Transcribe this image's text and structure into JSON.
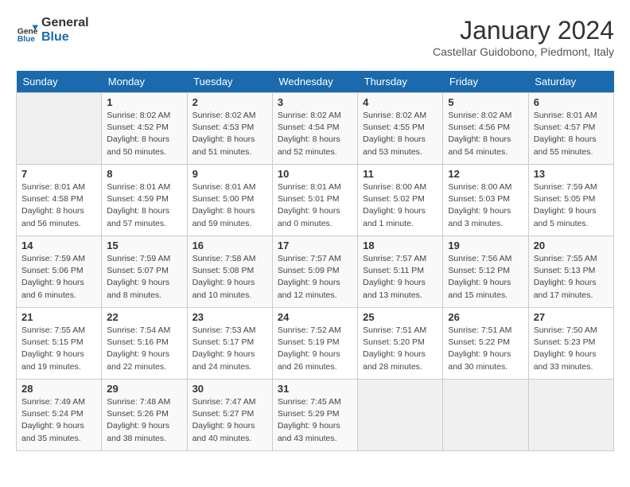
{
  "header": {
    "logo_line1": "General",
    "logo_line2": "Blue",
    "month": "January 2024",
    "location": "Castellar Guidobono, Piedmont, Italy"
  },
  "days_of_week": [
    "Sunday",
    "Monday",
    "Tuesday",
    "Wednesday",
    "Thursday",
    "Friday",
    "Saturday"
  ],
  "weeks": [
    [
      {
        "day": "",
        "info": ""
      },
      {
        "day": "1",
        "info": "Sunrise: 8:02 AM\nSunset: 4:52 PM\nDaylight: 8 hours\nand 50 minutes."
      },
      {
        "day": "2",
        "info": "Sunrise: 8:02 AM\nSunset: 4:53 PM\nDaylight: 8 hours\nand 51 minutes."
      },
      {
        "day": "3",
        "info": "Sunrise: 8:02 AM\nSunset: 4:54 PM\nDaylight: 8 hours\nand 52 minutes."
      },
      {
        "day": "4",
        "info": "Sunrise: 8:02 AM\nSunset: 4:55 PM\nDaylight: 8 hours\nand 53 minutes."
      },
      {
        "day": "5",
        "info": "Sunrise: 8:02 AM\nSunset: 4:56 PM\nDaylight: 8 hours\nand 54 minutes."
      },
      {
        "day": "6",
        "info": "Sunrise: 8:01 AM\nSunset: 4:57 PM\nDaylight: 8 hours\nand 55 minutes."
      }
    ],
    [
      {
        "day": "7",
        "info": "Sunrise: 8:01 AM\nSunset: 4:58 PM\nDaylight: 8 hours\nand 56 minutes."
      },
      {
        "day": "8",
        "info": "Sunrise: 8:01 AM\nSunset: 4:59 PM\nDaylight: 8 hours\nand 57 minutes."
      },
      {
        "day": "9",
        "info": "Sunrise: 8:01 AM\nSunset: 5:00 PM\nDaylight: 8 hours\nand 59 minutes."
      },
      {
        "day": "10",
        "info": "Sunrise: 8:01 AM\nSunset: 5:01 PM\nDaylight: 9 hours\nand 0 minutes."
      },
      {
        "day": "11",
        "info": "Sunrise: 8:00 AM\nSunset: 5:02 PM\nDaylight: 9 hours\nand 1 minute."
      },
      {
        "day": "12",
        "info": "Sunrise: 8:00 AM\nSunset: 5:03 PM\nDaylight: 9 hours\nand 3 minutes."
      },
      {
        "day": "13",
        "info": "Sunrise: 7:59 AM\nSunset: 5:05 PM\nDaylight: 9 hours\nand 5 minutes."
      }
    ],
    [
      {
        "day": "14",
        "info": "Sunrise: 7:59 AM\nSunset: 5:06 PM\nDaylight: 9 hours\nand 6 minutes."
      },
      {
        "day": "15",
        "info": "Sunrise: 7:59 AM\nSunset: 5:07 PM\nDaylight: 9 hours\nand 8 minutes."
      },
      {
        "day": "16",
        "info": "Sunrise: 7:58 AM\nSunset: 5:08 PM\nDaylight: 9 hours\nand 10 minutes."
      },
      {
        "day": "17",
        "info": "Sunrise: 7:57 AM\nSunset: 5:09 PM\nDaylight: 9 hours\nand 12 minutes."
      },
      {
        "day": "18",
        "info": "Sunrise: 7:57 AM\nSunset: 5:11 PM\nDaylight: 9 hours\nand 13 minutes."
      },
      {
        "day": "19",
        "info": "Sunrise: 7:56 AM\nSunset: 5:12 PM\nDaylight: 9 hours\nand 15 minutes."
      },
      {
        "day": "20",
        "info": "Sunrise: 7:55 AM\nSunset: 5:13 PM\nDaylight: 9 hours\nand 17 minutes."
      }
    ],
    [
      {
        "day": "21",
        "info": "Sunrise: 7:55 AM\nSunset: 5:15 PM\nDaylight: 9 hours\nand 19 minutes."
      },
      {
        "day": "22",
        "info": "Sunrise: 7:54 AM\nSunset: 5:16 PM\nDaylight: 9 hours\nand 22 minutes."
      },
      {
        "day": "23",
        "info": "Sunrise: 7:53 AM\nSunset: 5:17 PM\nDaylight: 9 hours\nand 24 minutes."
      },
      {
        "day": "24",
        "info": "Sunrise: 7:52 AM\nSunset: 5:19 PM\nDaylight: 9 hours\nand 26 minutes."
      },
      {
        "day": "25",
        "info": "Sunrise: 7:51 AM\nSunset: 5:20 PM\nDaylight: 9 hours\nand 28 minutes."
      },
      {
        "day": "26",
        "info": "Sunrise: 7:51 AM\nSunset: 5:22 PM\nDaylight: 9 hours\nand 30 minutes."
      },
      {
        "day": "27",
        "info": "Sunrise: 7:50 AM\nSunset: 5:23 PM\nDaylight: 9 hours\nand 33 minutes."
      }
    ],
    [
      {
        "day": "28",
        "info": "Sunrise: 7:49 AM\nSunset: 5:24 PM\nDaylight: 9 hours\nand 35 minutes."
      },
      {
        "day": "29",
        "info": "Sunrise: 7:48 AM\nSunset: 5:26 PM\nDaylight: 9 hours\nand 38 minutes."
      },
      {
        "day": "30",
        "info": "Sunrise: 7:47 AM\nSunset: 5:27 PM\nDaylight: 9 hours\nand 40 minutes."
      },
      {
        "day": "31",
        "info": "Sunrise: 7:45 AM\nSunset: 5:29 PM\nDaylight: 9 hours\nand 43 minutes."
      },
      {
        "day": "",
        "info": ""
      },
      {
        "day": "",
        "info": ""
      },
      {
        "day": "",
        "info": ""
      }
    ]
  ]
}
